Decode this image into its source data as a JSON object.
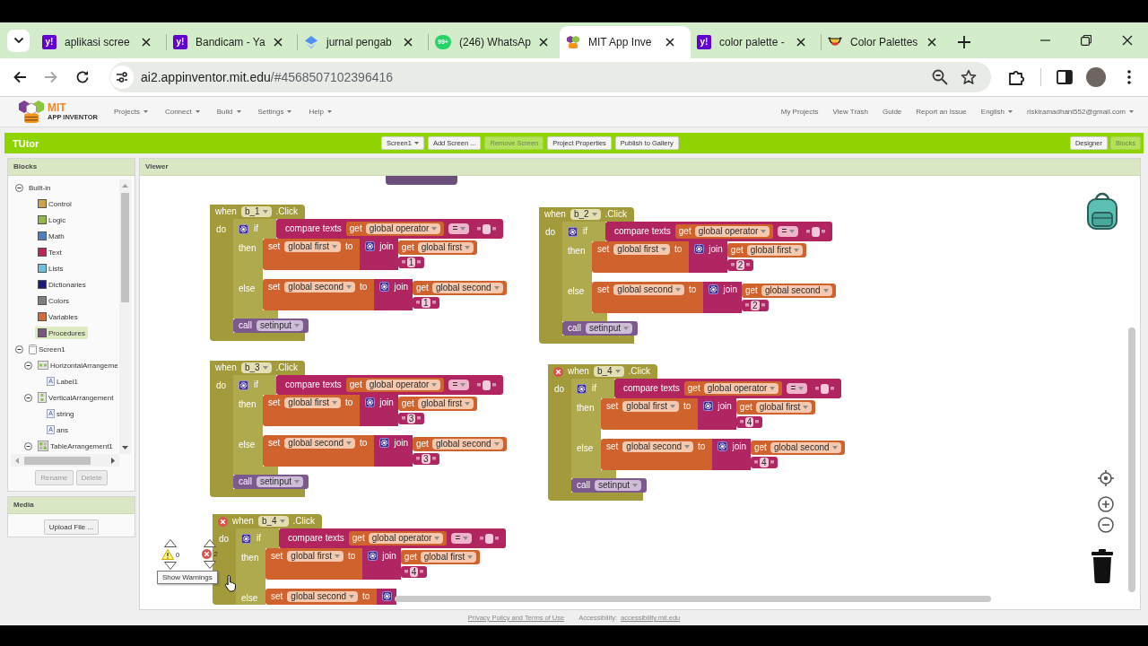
{
  "browser": {
    "tabs": [
      {
        "kind": "yahoo",
        "favicon": "y!",
        "title": "aplikasi scree",
        "selected": false
      },
      {
        "kind": "yahoo",
        "favicon": "y!",
        "title": "Bandicam - Ya",
        "selected": false
      },
      {
        "kind": "diamond",
        "title": "jurnal pengab",
        "selected": false
      },
      {
        "kind": "whatsapp",
        "badge": "99+",
        "title": "(246) WhatsAp",
        "selected": false
      },
      {
        "kind": "mit",
        "title": "MIT App Inve",
        "selected": true
      },
      {
        "kind": "yahoo",
        "favicon": "y!",
        "title": "color palette -",
        "selected": false
      },
      {
        "kind": "bowl",
        "title": "Color Palettes",
        "selected": false
      }
    ],
    "nav": [
      {
        "kind": "back",
        "disabled": false
      },
      {
        "kind": "forward",
        "disabled": true
      },
      {
        "kind": "reload",
        "disabled": false
      }
    ],
    "address": {
      "host": "ai2.appinventor.mit.edu",
      "path": "/#4568507102396416"
    }
  },
  "app": {
    "logo": {
      "title": "MIT",
      "subtitle": "APP INVENTOR"
    },
    "menus": [
      {
        "label": "Projects",
        "dropdown": true
      },
      {
        "label": "Connect",
        "dropdown": true
      },
      {
        "label": "Build",
        "dropdown": true
      },
      {
        "label": "Settings",
        "dropdown": true
      },
      {
        "label": "Help",
        "dropdown": true
      }
    ],
    "links": [
      {
        "label": "My Projects",
        "dropdown": false
      },
      {
        "label": "View Trash",
        "dropdown": false
      },
      {
        "label": "Guide",
        "dropdown": false
      },
      {
        "label": "Report an Issue",
        "dropdown": false
      },
      {
        "label": "English",
        "dropdown": true
      },
      {
        "label": "riskiramadhani552@gmail.com",
        "dropdown": true
      }
    ]
  },
  "toolbar": {
    "project": "TUtor",
    "buttons": [
      {
        "label": "Screen1",
        "dropdown": true,
        "disabled": false
      },
      {
        "label": "Add Screen ...",
        "dropdown": false,
        "disabled": false
      },
      {
        "label": "Remove Screen",
        "dropdown": false,
        "disabled": true
      },
      {
        "label": "Project Properties",
        "dropdown": false,
        "disabled": false
      },
      {
        "label": "Publish to Gallery",
        "dropdown": false,
        "disabled": false
      }
    ],
    "views": [
      {
        "label": "Designer",
        "selected": false
      },
      {
        "label": "Blocks",
        "selected": true
      }
    ]
  },
  "blocks_panel": {
    "title": "Blocks",
    "tree": [
      {
        "kind": "folder",
        "label": "Built-in",
        "expanded": true,
        "selected": false,
        "children": [
          {
            "kind": "category",
            "label": "Control",
            "color": "#c9a548",
            "selected": false
          },
          {
            "kind": "category",
            "label": "Logic",
            "color": "#8dba4a",
            "selected": false
          },
          {
            "kind": "category",
            "label": "Math",
            "color": "#4f7dc1",
            "selected": false
          },
          {
            "kind": "category",
            "label": "Text",
            "color": "#b5275d",
            "selected": false
          },
          {
            "kind": "category",
            "label": "Lists",
            "color": "#6bc0dd",
            "selected": false
          },
          {
            "kind": "category",
            "label": "Dictionaries",
            "color": "#1a1b7c",
            "selected": false
          },
          {
            "kind": "category",
            "label": "Colors",
            "color": "#7f7f7f",
            "selected": false
          },
          {
            "kind": "category",
            "label": "Variables",
            "color": "#d4693a",
            "selected": false
          },
          {
            "kind": "category",
            "label": "Procedures",
            "color": "#7a5680",
            "selected": true
          }
        ]
      },
      {
        "kind": "screen",
        "label": "Screen1",
        "expanded": true,
        "selected": false,
        "children": [
          {
            "kind": "horizontal",
            "label": "HorizontalArrangeme",
            "expanded": true,
            "selected": false,
            "children": [
              {
                "kind": "label",
                "icon": "A",
                "label": "Label1",
                "selected": false
              }
            ]
          },
          {
            "kind": "vertical",
            "label": "VerticalArrangement",
            "expanded": true,
            "selected": false,
            "children": [
              {
                "kind": "label",
                "icon": "A",
                "label": "string",
                "selected": false
              },
              {
                "kind": "label",
                "icon": "A",
                "label": "ans",
                "selected": false
              }
            ]
          },
          {
            "kind": "table",
            "label": "TableArrangement1",
            "expanded": true,
            "selected": false
          }
        ]
      }
    ],
    "buttons": [
      {
        "label": "Rename",
        "disabled": true
      },
      {
        "label": "Delete",
        "disabled": true
      }
    ]
  },
  "media_panel": {
    "title": "Media",
    "buttons": [
      {
        "label": "Upload File ...",
        "disabled": false
      }
    ]
  },
  "viewer": {
    "title": "Viewer",
    "blocks": [
      {
        "error": false,
        "when": "when",
        "component": "b_1",
        "event": ".Click",
        "do": "do",
        "if": {
          "label": "if",
          "condition": {
            "label": "compare texts",
            "get": "get",
            "variable": "global operator",
            "operator": "="
          },
          "branches": [
            {
              "label": "then",
              "set": "set",
              "variable": "global first",
              "to": "to",
              "join": "join",
              "get": "get",
              "get_variable": "global first",
              "text": "1"
            },
            {
              "label": "else",
              "set": "set",
              "variable": "global second",
              "to": "to",
              "join": "join",
              "get": "get",
              "get_variable": "global second",
              "text": "1"
            }
          ]
        },
        "call": {
          "label": "call",
          "procedure": "setinput"
        }
      },
      {
        "error": false,
        "when": "when",
        "component": "b_2",
        "event": ".Click",
        "do": "do",
        "if": {
          "label": "if",
          "condition": {
            "label": "compare texts",
            "get": "get",
            "variable": "global operator",
            "operator": "="
          },
          "branches": [
            {
              "label": "then",
              "set": "set",
              "variable": "global first",
              "to": "to",
              "join": "join",
              "get": "get",
              "get_variable": "global first",
              "text": "2"
            },
            {
              "label": "else",
              "set": "set",
              "variable": "global second",
              "to": "to",
              "join": "join",
              "get": "get",
              "get_variable": "global second",
              "text": "2"
            }
          ]
        },
        "call": {
          "label": "call",
          "procedure": "setinput"
        }
      },
      {
        "error": false,
        "when": "when",
        "component": "b_3",
        "event": ".Click",
        "do": "do",
        "if": {
          "label": "if",
          "condition": {
            "label": "compare texts",
            "get": "get",
            "variable": "global operator",
            "operator": "="
          },
          "branches": [
            {
              "label": "then",
              "set": "set",
              "variable": "global first",
              "to": "to",
              "join": "join",
              "get": "get",
              "get_variable": "global first",
              "text": "3"
            },
            {
              "label": "else",
              "set": "set",
              "variable": "global second",
              "to": "to",
              "join": "join",
              "get": "get",
              "get_variable": "global second",
              "text": "3"
            }
          ]
        },
        "call": {
          "label": "call",
          "procedure": "setinput"
        }
      },
      {
        "error": true,
        "when": "when",
        "component": "b_4",
        "event": ".Click",
        "do": "do",
        "if": {
          "label": "if",
          "condition": {
            "label": "compare texts",
            "get": "get",
            "variable": "global operator",
            "operator": "="
          },
          "branches": [
            {
              "label": "then",
              "set": "set",
              "variable": "global first",
              "to": "to",
              "join": "join",
              "get": "get",
              "get_variable": "global first",
              "text": "4"
            },
            {
              "label": "else",
              "set": "set",
              "variable": "global second",
              "to": "to",
              "join": "join",
              "get": "get",
              "get_variable": "global second",
              "text": "4"
            }
          ]
        },
        "call": {
          "label": "call",
          "procedure": "setinput"
        }
      },
      {
        "error": true,
        "when": "when",
        "component": "b_4",
        "event": ".Click",
        "do": "do",
        "if": {
          "label": "if",
          "condition": {
            "label": "compare texts",
            "get": "get",
            "variable": "global operator",
            "operator": "="
          },
          "branches": [
            {
              "label": "then",
              "set": "set",
              "variable": "global first",
              "to": "to",
              "join": "join",
              "get": "get",
              "get_variable": "global first",
              "text": "4"
            },
            {
              "label": "else",
              "set": "set",
              "variable": "global second",
              "to": "to"
            }
          ]
        }
      }
    ],
    "warnings": {
      "warning_count": "0",
      "error_count": "2",
      "button": "Show Warnings"
    }
  },
  "footer": {
    "items": [
      {
        "kind": "link",
        "text": "Privacy Policy and Terms of Use"
      },
      {
        "kind": "text",
        "text": "Accessibility:"
      },
      {
        "kind": "link",
        "text": "accessibility.mit.edu"
      }
    ]
  }
}
